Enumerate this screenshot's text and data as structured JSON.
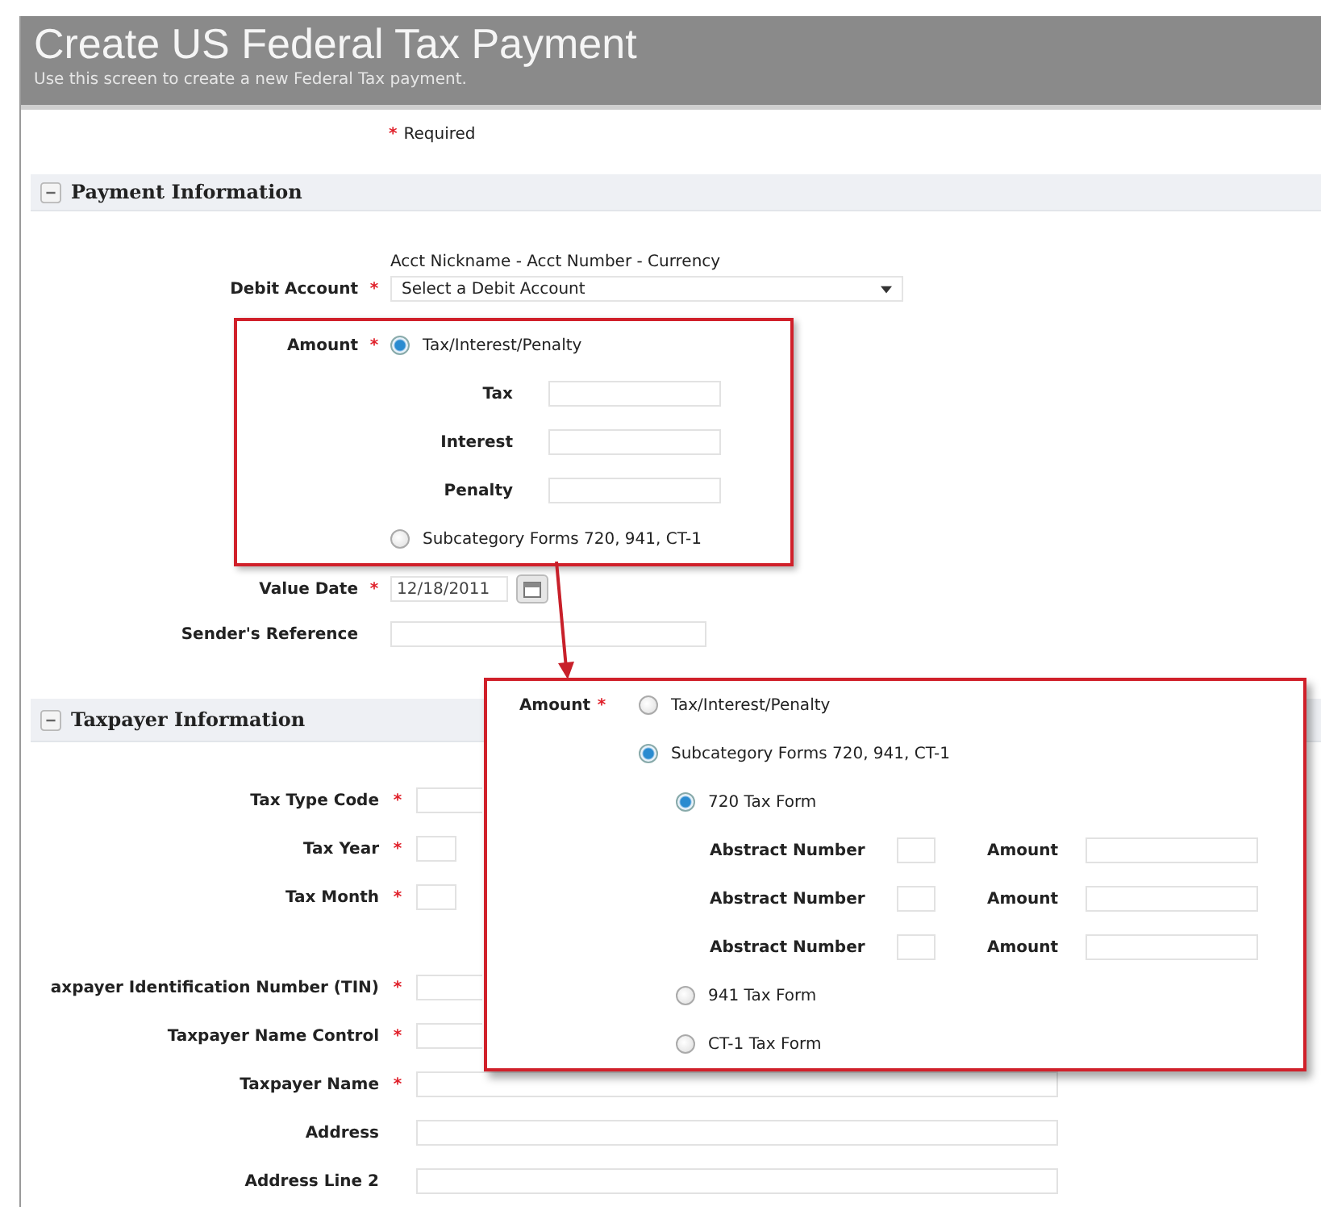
{
  "header": {
    "title": "Create US Federal Tax Payment",
    "subtitle": "Use this screen to create a new Federal Tax payment."
  },
  "required_note": {
    "mark": "*",
    "text": "Required"
  },
  "payment_section": {
    "title": "Payment Information",
    "debit_account": {
      "hint": "Acct Nickname - Acct Number - Currency",
      "label": "Debit Account",
      "required_mark": "*",
      "value": "Select a Debit Account"
    },
    "amount": {
      "label": "Amount",
      "required_mark": "*",
      "options": [
        {
          "label": "Tax/Interest/Penalty",
          "selected": true
        },
        {
          "label": "Subcategory Forms 720, 941, CT-1",
          "selected": false
        }
      ],
      "fields": [
        {
          "label": "Tax"
        },
        {
          "label": "Interest"
        },
        {
          "label": "Penalty"
        }
      ]
    },
    "value_date": {
      "label": "Value Date",
      "required_mark": "*",
      "value": "12/18/2011"
    },
    "senders_reference": {
      "label": "Sender's Reference"
    }
  },
  "taxpayer_section": {
    "title": "Taxpayer Information",
    "field_groups": [
      [
        {
          "label": "Tax Type Code",
          "required_mark": "*",
          "kind": "partial"
        },
        {
          "label": "Tax Year",
          "required_mark": "*",
          "kind": "short"
        },
        {
          "label": "Tax Month",
          "required_mark": "*",
          "kind": "short"
        }
      ],
      [
        {
          "label": "axpayer Identification Number (TIN)",
          "required_mark": "*",
          "kind": "partial"
        },
        {
          "label": "Taxpayer Name Control",
          "required_mark": "*",
          "kind": "partial"
        },
        {
          "label": "Taxpayer Name",
          "required_mark": "*",
          "kind": "text"
        },
        {
          "label": "Address",
          "kind": "text"
        },
        {
          "label": "Address Line 2",
          "kind": "text"
        }
      ]
    ]
  },
  "callout": {
    "label": "Amount",
    "required_mark": "*",
    "options": [
      {
        "label": "Tax/Interest/Penalty",
        "selected": false
      },
      {
        "label": "Subcategory Forms 720, 941, CT-1",
        "selected": true
      }
    ],
    "forms": [
      {
        "label": "720 Tax Form",
        "selected": true,
        "rows": [
          {
            "number_label": "Abstract Number",
            "amount_label": "Amount"
          },
          {
            "number_label": "Abstract Number",
            "amount_label": "Amount"
          },
          {
            "number_label": "Abstract Number",
            "amount_label": "Amount"
          }
        ]
      },
      {
        "label": "941 Tax Form",
        "selected": false
      },
      {
        "label": "CT-1 Tax Form",
        "selected": false
      }
    ]
  }
}
